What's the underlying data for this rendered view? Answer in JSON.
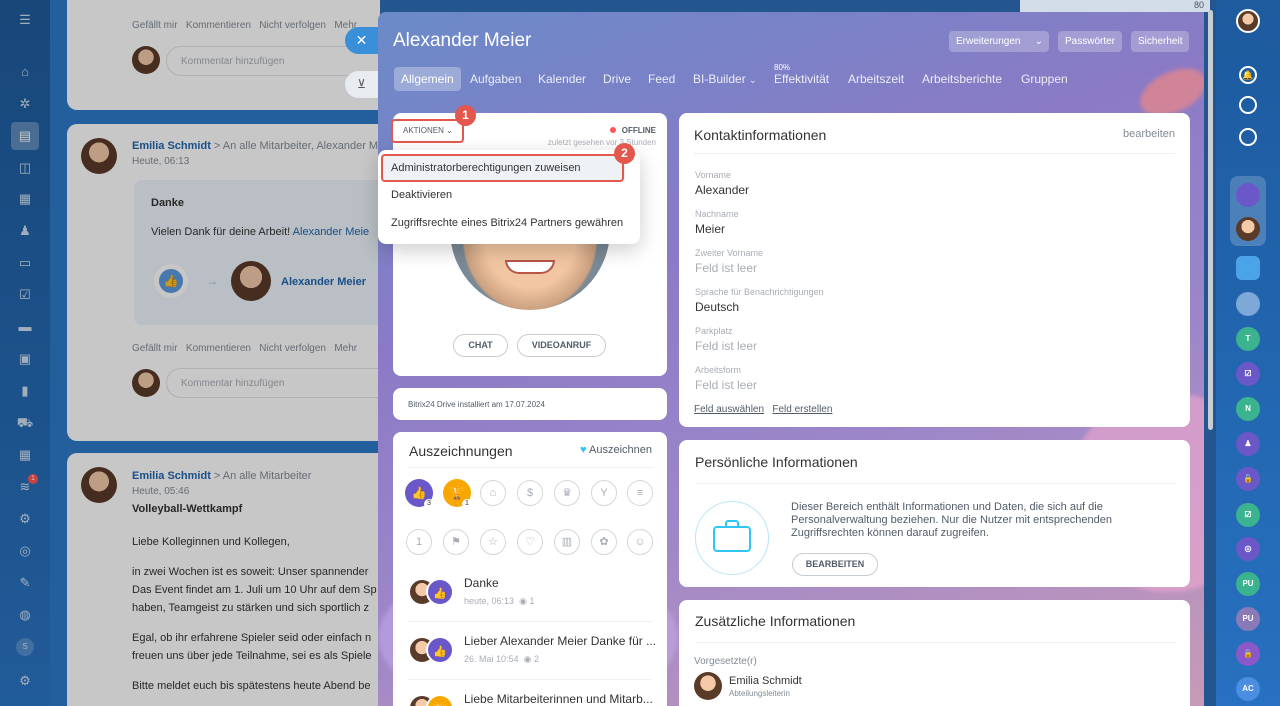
{
  "feed": {
    "post1": {
      "actions": [
        "Gefällt mir",
        "Kommentieren",
        "Nicht verfolgen",
        "Mehr"
      ],
      "comment_placeholder": "Kommentar hinzufügen"
    },
    "post2": {
      "author": "Emilia Schmidt",
      "recipients": "An alle Mitarbeiter, Alexander M",
      "time": "Heute, 06:13",
      "title": "Danke",
      "text": "Vielen Dank für deine Arbeit!",
      "mention": "Alexander Meie",
      "recipient_name": "Alexander Meier",
      "actions": [
        "Gefällt mir",
        "Kommentieren",
        "Nicht verfolgen",
        "Mehr"
      ],
      "comment_placeholder": "Kommentar hinzufügen"
    },
    "post3": {
      "author": "Emilia Schmidt",
      "recipients": "An alle Mitarbeiter",
      "time": "Heute, 05:46",
      "title": "Volleyball-Wettkampf",
      "p1": "Liebe Kolleginnen und Kollegen,",
      "p2a": "in zwei Wochen ist es soweit: Unser spannender",
      "p2b": "Das Event findet am 1. Juli um 10 Uhr auf dem Sp",
      "p2c": "haben, Teamgeist zu stärken und sich sportlich z",
      "p3a": "Egal, ob ihr erfahrene Spieler seid oder einfach n",
      "p3b": "freuen uns über jede Teilnahme, sei es als Spiele",
      "p4": "Bitte meldet euch bis spätestens heute Abend be"
    }
  },
  "left_badge_count": "1",
  "left_bottom_label": "S",
  "profile": {
    "name": "Alexander Meier",
    "header_buttons": {
      "extensions": "Erweiterungen",
      "passwords": "Passwörter",
      "security": "Sicherheit"
    },
    "tabs": [
      "Allgemein",
      "Aufgaben",
      "Kalender",
      "Drive",
      "Feed",
      "BI-Builder",
      "Effektivität",
      "Arbeitszeit",
      "Arbeitsberichte",
      "Gruppen"
    ],
    "efficiency_percent": "80%",
    "actions_label": "AKTIONEN",
    "status": "OFFLINE",
    "last_seen": "zuletzt gesehen vor 3 Stunden",
    "chat_button": "CHAT",
    "video_button": "VIDEOANRUF",
    "drive_info": "Bitrix24 Drive installiert am 17.07.2024",
    "menu": [
      "Administratorberechtigungen zuweisen",
      "Deaktivieren",
      "Zugriffsrechte eines Bitrix24 Partners gewähren"
    ],
    "step1": "1",
    "step2": "2"
  },
  "awards": {
    "title": "Auszeichnungen",
    "action": "Auszeichnen",
    "count_like": "3",
    "count_cup": "1",
    "items": [
      {
        "title": "Danke",
        "meta": "heute, 06:13",
        "views": "1"
      },
      {
        "title": "Lieber Alexander Meier Danke für ...",
        "meta": "26. Mai 10:54",
        "views": "2"
      },
      {
        "title": "Liebe Mitarbeiterinnen und Mitarb..."
      }
    ]
  },
  "contact": {
    "title": "Kontaktinformationen",
    "edit": "bearbeiten",
    "fields": [
      {
        "label": "Vorname",
        "value": "Alexander"
      },
      {
        "label": "Nachname",
        "value": "Meier"
      },
      {
        "label": "Zweiter Vorname",
        "value": "Feld ist leer"
      },
      {
        "label": "Sprache für Benachrichtigungen",
        "value": "Deutsch"
      },
      {
        "label": "Parkplatz",
        "value": "Feld ist leer"
      },
      {
        "label": "Arbeitsform",
        "value": "Feld ist leer"
      }
    ],
    "select_field": "Feld auswählen",
    "create_field": "Feld erstellen"
  },
  "personal": {
    "title": "Persönliche Informationen",
    "text": "Dieser Bereich enthält Informationen und Daten, die sich auf die Personalverwaltung beziehen. Nur die Nutzer mit entsprechenden Zugriffsrechten können darauf zugreifen.",
    "button": "BEARBEITEN"
  },
  "additional": {
    "title": "Zusätzliche Informationen",
    "supervisor_label": "Vorgesetzte(r)",
    "supervisor_name": "Emilia Schmidt",
    "supervisor_role": "Abteilungsleiterin"
  },
  "right_bar": {
    "top_number": "80",
    "avatars": [
      "T",
      "N",
      "PU",
      "PU",
      "AC"
    ]
  }
}
